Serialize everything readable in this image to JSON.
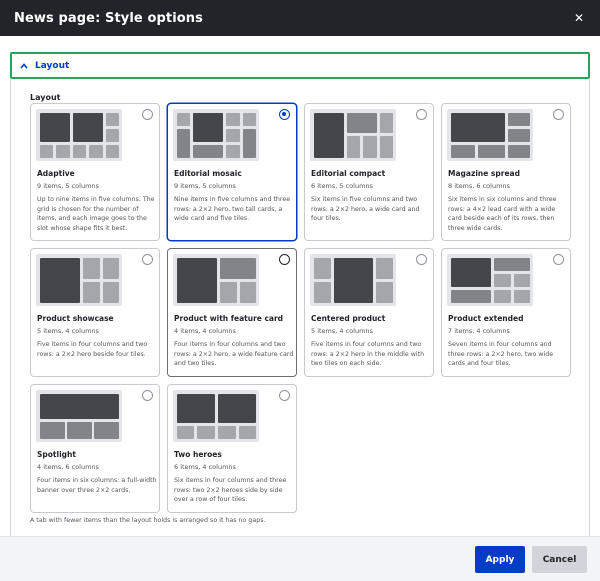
{
  "dialog": {
    "title": "News page: Style options",
    "close_icon": "close-icon"
  },
  "section": {
    "summary": "Layout",
    "expanded": true,
    "group_label": "Layout"
  },
  "options": [
    {
      "name": "Adaptive",
      "meta": "9 items, 5 columns",
      "desc": "Up to nine items in five columns. The grid is chosen for the number of items, and each image goes to the slot whose shape fits it best.",
      "selected": false
    },
    {
      "name": "Editorial mosaic",
      "meta": "9 items, 5 columns",
      "desc": "Nine items in five columns and three rows: a 2×2 hero, two tall cards, a wide card and five tiles.",
      "selected": true
    },
    {
      "name": "Editorial compact",
      "meta": "6 items, 5 columns",
      "desc": "Six items in five columns and two rows: a 2×2 hero, a wide card and four tiles.",
      "selected": false
    },
    {
      "name": "Magazine spread",
      "meta": "8 items, 6 columns",
      "desc": "Six items in six columns and three rows: a 4×2 lead card with a wide card beside each of its rows, then three wide cards.",
      "selected": false
    },
    {
      "name": "Product showcase",
      "meta": "5 items, 4 columns",
      "desc": "Five items in four columns and two rows: a 2×2 hero beside four tiles.",
      "selected": false
    },
    {
      "name": "Product with feature card",
      "meta": "4 items, 4 columns",
      "desc": "Four items in four columns and two rows: a 2×2 hero, a wide feature card and two tiles.",
      "selected": false
    },
    {
      "name": "Centered product",
      "meta": "5 items, 4 columns",
      "desc": "Five items in four columns and two rows: a 2×2 hero in the middle with two tiles on each side.",
      "selected": false
    },
    {
      "name": "Product extended",
      "meta": "7 items, 4 columns",
      "desc": "Seven items in four columns and three rows: a 2×2 hero, two wide cards and four tiles.",
      "selected": false
    },
    {
      "name": "Spotlight",
      "meta": "4 items, 6 columns",
      "desc": "Four items in six columns: a full-width banner over three 2×2 cards.",
      "selected": false
    },
    {
      "name": "Two heroes",
      "meta": "6 items, 4 columns",
      "desc": "Six items in four columns and three rows: two 2×2 heroes side by side over a row of four tiles.",
      "selected": false
    }
  ],
  "note": "A tab with fewer items than the layout holds is arranged so it has no gaps.",
  "footer": {
    "apply_label": "Apply",
    "cancel_label": "Cancel"
  },
  "colors": {
    "titlebar": "#232429",
    "accent": "#003cc5",
    "focus_border": "#29a35a"
  }
}
